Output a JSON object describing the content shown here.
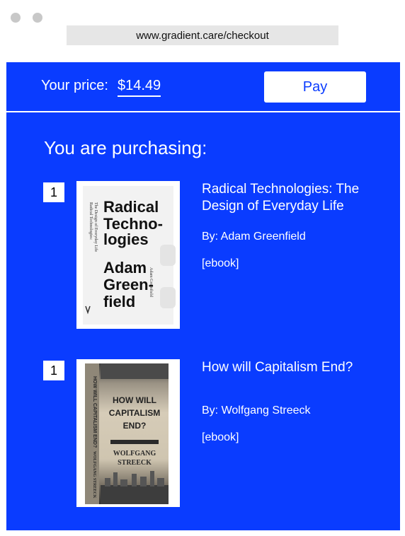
{
  "browser": {
    "url": "www.gradient.care/checkout"
  },
  "checkout": {
    "price_label": "Your price:",
    "price_value": "$14.49",
    "pay_label": "Pay",
    "heading": "You are purchasing:"
  },
  "items": [
    {
      "qty": "1",
      "title": "Radical Technologies: The Design of Everyday Life",
      "author": "By: Adam Greenfield",
      "format": "[ebook]",
      "cover": {
        "spine_lines": [
          "Radical Technologies:",
          "The Design of Everyday Life"
        ],
        "spine_author": "Adam Greenfield",
        "title_lines": [
          "Radical",
          "Techno-",
          "logies"
        ],
        "author_lines": [
          "Adam",
          "Green-",
          "field"
        ]
      }
    },
    {
      "qty": "1",
      "title": "How will Capitalism End?",
      "author": "By: Wolfgang Streeck",
      "format": "[ebook]",
      "cover": {
        "spine_text": "HOW WILL CAPITALISM END?",
        "spine_author": "WOLFGANG STREECK",
        "title_lines": [
          "HOW WILL",
          "CAPITALISM",
          "END?"
        ],
        "author_lines": [
          "WOLFGANG",
          "STREECK"
        ]
      }
    }
  ],
  "colors": {
    "accent": "#0a3cff",
    "panel_text": "#ffffff",
    "urlbar": "#e6e6e6"
  }
}
